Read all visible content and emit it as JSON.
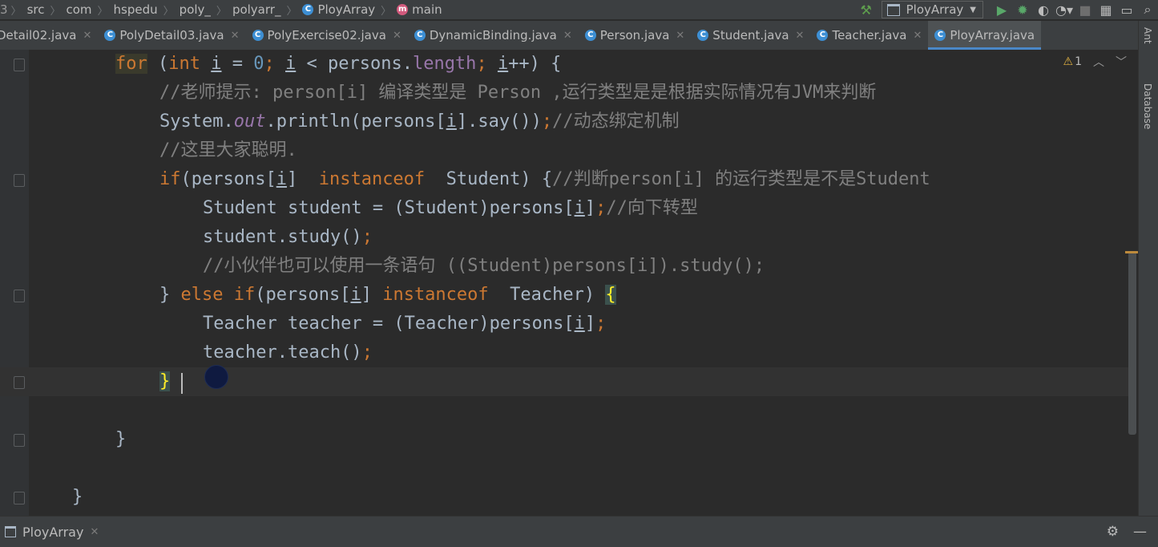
{
  "breadcrumb": {
    "items": [
      "src",
      "com",
      "hspedu",
      "poly_",
      "polyarr_",
      "PloyArray",
      "main"
    ]
  },
  "toolbar": {
    "run_config": "PloyArray"
  },
  "tabs": [
    {
      "label": "Detail02.java"
    },
    {
      "label": "PolyDetail03.java"
    },
    {
      "label": "PolyExercise02.java"
    },
    {
      "label": "DynamicBinding.java"
    },
    {
      "label": "Person.java"
    },
    {
      "label": "Student.java"
    },
    {
      "label": "Teacher.java"
    },
    {
      "label": "PloyArray.java",
      "active": true
    }
  ],
  "right_tools": {
    "ant": "Ant",
    "database": "Database"
  },
  "inspection": {
    "warnings": "1"
  },
  "code": {
    "for_kw": "for",
    "int_kw": "int",
    "i_var": "i",
    "lt": " < persons.",
    "length": "length",
    "semi1": ";",
    "l1_tail": "++) {",
    "comment1": "//老师提示: person[i] 编译类型是 Person ,运行类型是是根据实际情况有JVM来判断",
    "system": "System.",
    "out": "out",
    "println": ".println(persons[",
    "say": "].say())",
    "comment2": "//动态绑定机制",
    "comment3": "//这里大家聪明.",
    "if1": "if(persons[",
    "instanceof1": "instanceof",
    "student_tail": "  Student) {",
    "comment4": "//判断person[i] 的运行类型是不是Student",
    "student_decl": "Student student = (Student)persons[",
    "comment5": "//向下转型",
    "student_study": "student.study()",
    "comment6": "//小伙伴也可以使用一条语句 ((Student)persons[i]).study();",
    "else_kw": "else",
    "if_kw": "if",
    "if2": "(persons[",
    "instanceof2": "instanceof",
    "teacher_tail": "  Teacher) ",
    "open_brace": "{",
    "teacher_decl": "Teacher teacher = (Teacher)persons[",
    "teacher_teach": "teacher.teach()",
    "close_brace": "}",
    "close_brace2": "}",
    "close_brace3": "}",
    "semicolon": ";",
    "zero": "0",
    "bracket_close": "]",
    "else_prefix": "} "
  },
  "bottom": {
    "tab_label": "PloyArray"
  }
}
